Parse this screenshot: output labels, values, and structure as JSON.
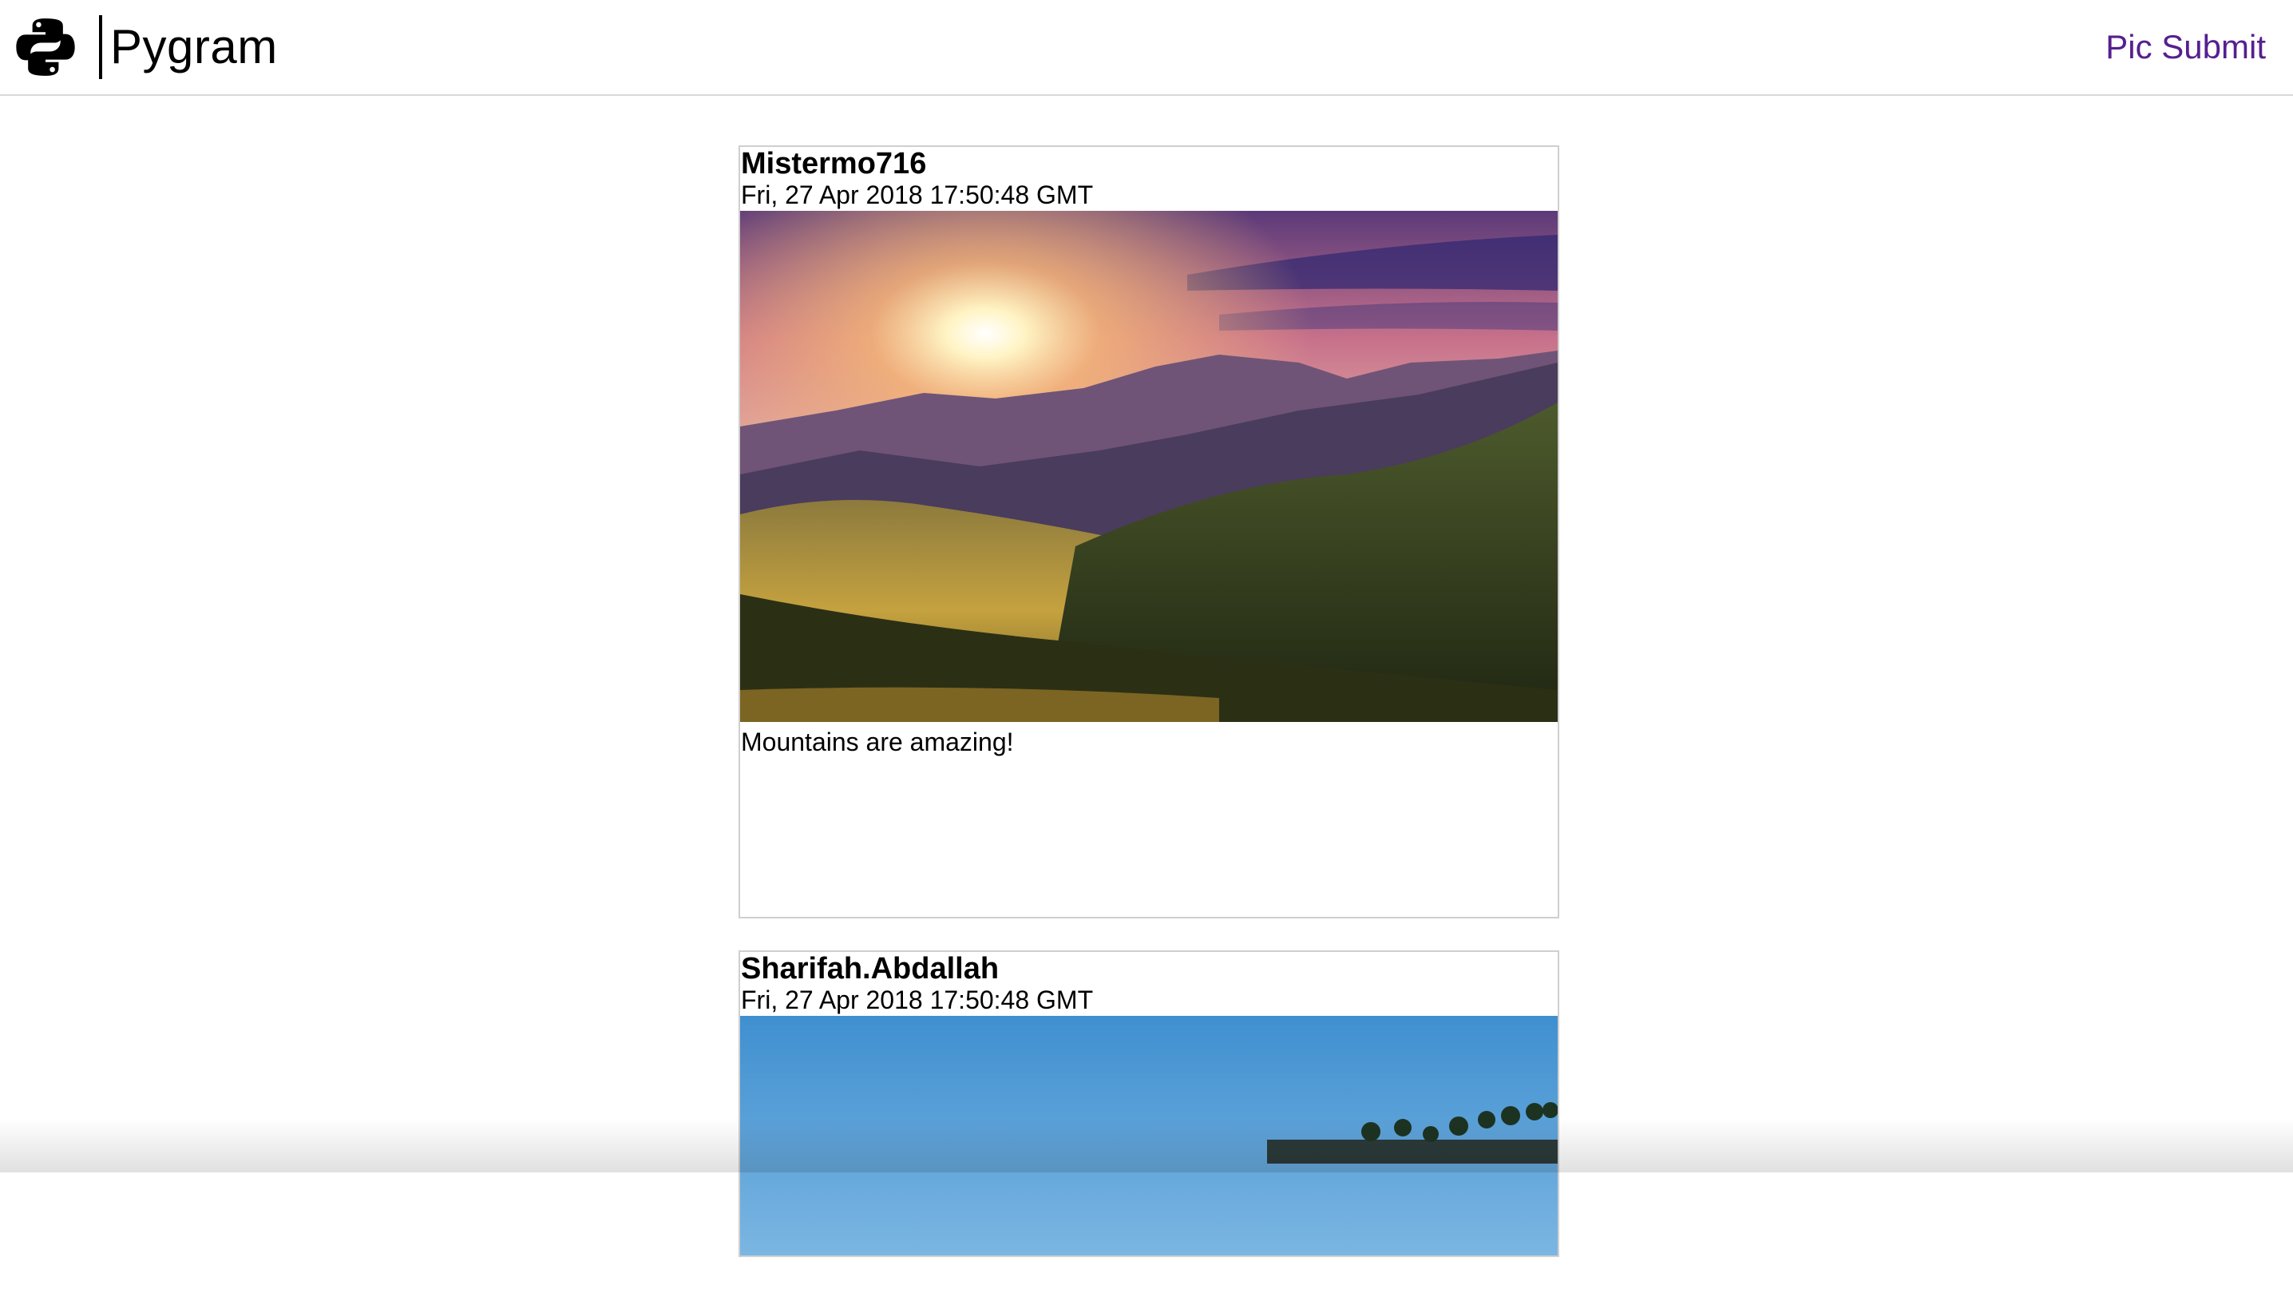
{
  "app": {
    "brand_name": "Pygram",
    "logo_icon": "python-logo-icon"
  },
  "nav": {
    "submit_label": "Pic Submit",
    "link_color": "#55208f"
  },
  "posts": [
    {
      "username": "Mistermo716",
      "date": "Fri, 27 Apr 2018 17:50:48 GMT",
      "image": "mountain-sunrise-photo",
      "caption": "Mountains are amazing!"
    },
    {
      "username": "Sharifah.Abdallah",
      "date": "Fri, 27 Apr 2018 17:50:48 GMT",
      "image": "blue-sky-palm-trees-photo",
      "caption": ""
    }
  ]
}
